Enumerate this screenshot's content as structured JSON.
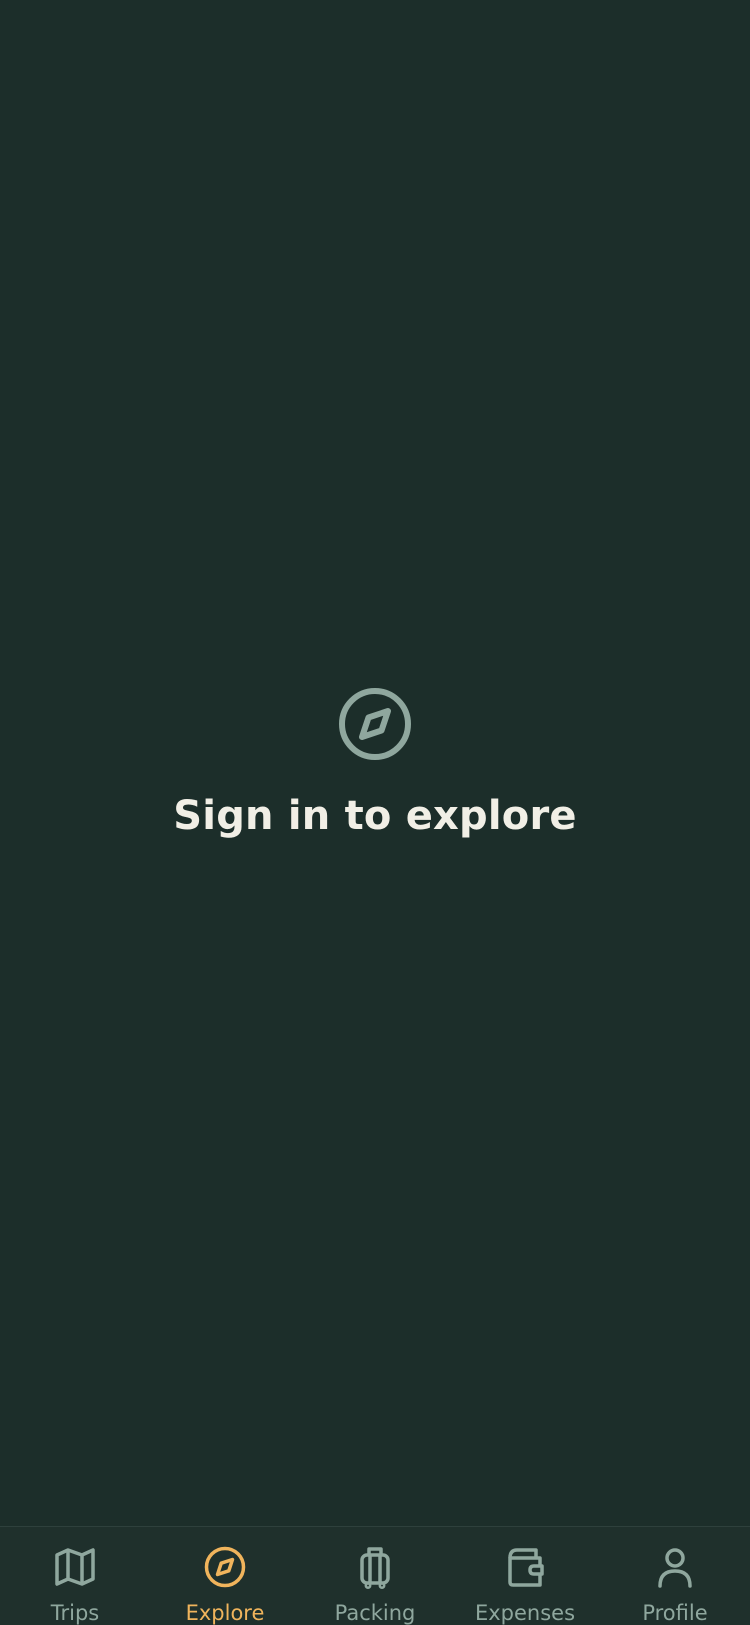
{
  "colors": {
    "background": "#1c2e2a",
    "tabbar_background": "#1f302c",
    "title_text": "#f1efe6",
    "icon_muted": "#8fa79e",
    "active_accent": "#f0b45c"
  },
  "empty_state": {
    "icon": "compass-icon",
    "title": "Sign in to explore"
  },
  "tabbar": {
    "active_index": 1,
    "tabs": [
      {
        "label": "Trips",
        "icon": "map-icon"
      },
      {
        "label": "Explore",
        "icon": "compass-icon"
      },
      {
        "label": "Packing",
        "icon": "luggage-icon"
      },
      {
        "label": "Expenses",
        "icon": "wallet-icon"
      },
      {
        "label": "Profile",
        "icon": "user-icon"
      }
    ]
  }
}
